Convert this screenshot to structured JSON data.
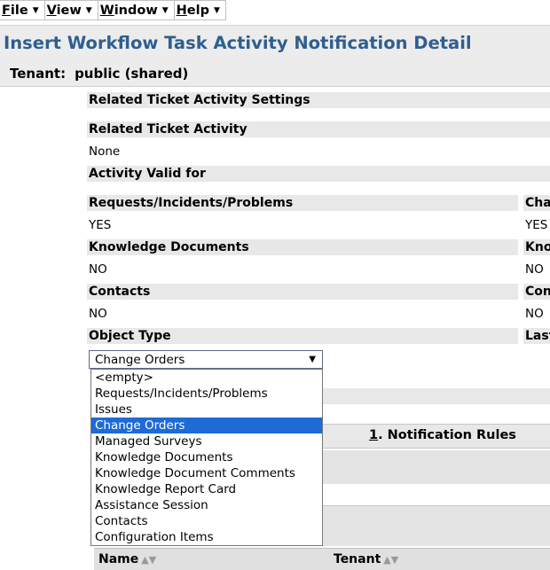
{
  "menu": {
    "file": {
      "key": "F",
      "rest": "ile"
    },
    "view": {
      "key": "V",
      "rest": "iew"
    },
    "window": {
      "key": "W",
      "rest": "indow"
    },
    "help": {
      "key": "H",
      "rest": "elp"
    }
  },
  "title": "Insert Workflow Task Activity Notification Detail",
  "tenant": {
    "label": "Tenant:",
    "value": "public (shared)"
  },
  "form": {
    "related_settings": "Related Ticket Activity Settings",
    "related_activity_label": "Related Ticket Activity",
    "related_activity_value": "None",
    "valid_for": "Activity Valid for",
    "rip_label": "Requests/Incidents/Problems",
    "rip_value": "YES",
    "co_label": "Cha",
    "co_value": "YES",
    "kd_label": "Knowledge Documents",
    "kd_value": "NO",
    "kd2_label": "Kno",
    "kd2_value": "NO",
    "contacts_label": "Contacts",
    "contacts_value": "NO",
    "com_label": "Con",
    "com_value": "NO",
    "object_type_label": "Object Type",
    "last_label": "Last"
  },
  "select": {
    "current": "Change Orders",
    "options": [
      "<empty>",
      "Requests/Incidents/Problems",
      "Issues",
      "Change Orders",
      "Managed Surveys",
      "Knowledge Documents",
      "Knowledge Document Comments",
      "Knowledge Report Card",
      "Assistance Session",
      "Contacts",
      "Configuration Items"
    ],
    "selected_index": 3
  },
  "tab": {
    "num": "1",
    "label": ". Notification Rules"
  },
  "table": {
    "col_name": "Name",
    "col_tenant": "Tenant"
  }
}
